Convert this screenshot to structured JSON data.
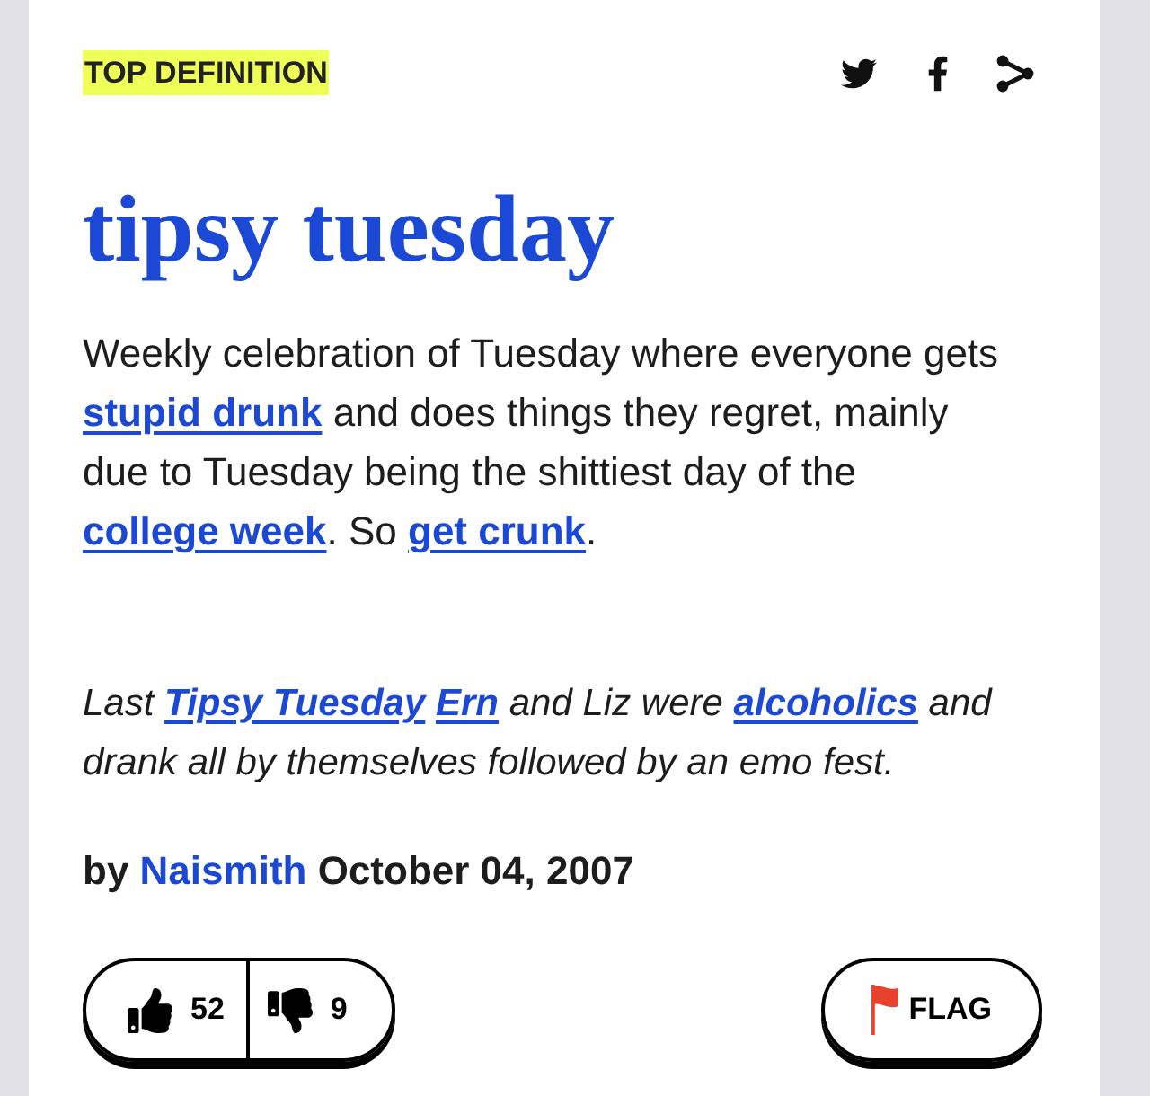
{
  "badge": "TOP DEFINITION",
  "word": "tipsy tuesday",
  "meaning": [
    {
      "kind": "text",
      "text": "Weekly celebration of Tuesday where everyone gets "
    },
    {
      "kind": "link",
      "text": "stupid drunk"
    },
    {
      "kind": "text",
      "text": " and does things they regret, mainly due to Tuesday being the shittiest day of the "
    },
    {
      "kind": "link",
      "text": "college week"
    },
    {
      "kind": "text",
      "text": ". So "
    },
    {
      "kind": "link",
      "text": "get crunk"
    },
    {
      "kind": "text",
      "text": "."
    }
  ],
  "example": [
    {
      "kind": "text",
      "text": "Last "
    },
    {
      "kind": "link",
      "text": "Tipsy Tuesday"
    },
    {
      "kind": "link",
      "text": "Ern"
    },
    {
      "kind": "text",
      "text": " and Liz were "
    },
    {
      "kind": "link",
      "text": "alcoholics"
    },
    {
      "kind": "text",
      "text": " and drank all by themselves followed by an emo fest."
    }
  ],
  "byline": [
    {
      "kind": "text",
      "text": "by "
    },
    {
      "kind": "link",
      "text": "Naismith"
    },
    {
      "kind": "text",
      "text": " October 04, 2007"
    }
  ],
  "votes": {
    "up": "52",
    "down": "9"
  },
  "flag_button": "FLAG"
}
